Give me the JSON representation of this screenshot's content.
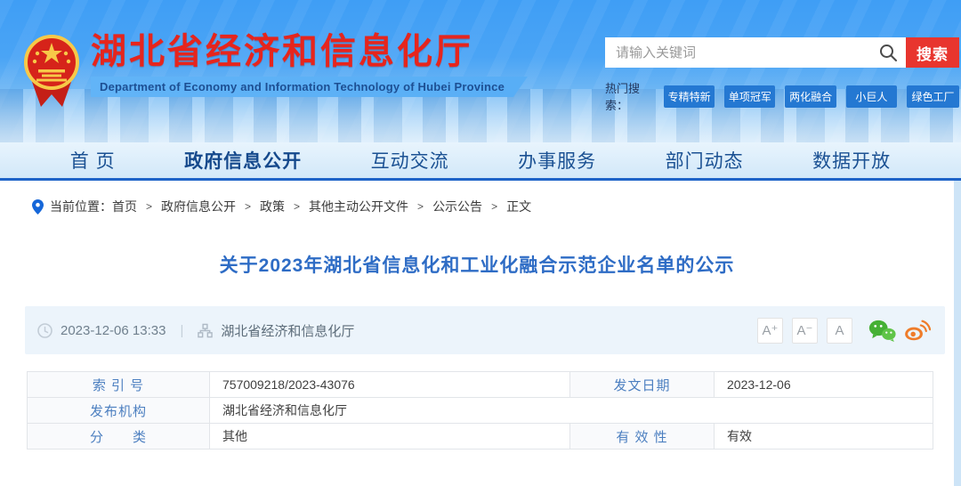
{
  "header": {
    "site_title": "湖北省经济和信息化厅",
    "site_subtitle": "Department of Economy and Information Technology of Hubei Province",
    "search": {
      "placeholder": "请输入关键词",
      "button_label": "搜索",
      "hot_label": "热门搜索：",
      "hot_tags": [
        "专精特新",
        "单项冠军",
        "两化融合",
        "小巨人",
        "绿色工厂"
      ]
    }
  },
  "nav": {
    "items": [
      {
        "label": "首 页",
        "active": false
      },
      {
        "label": "政府信息公开",
        "active": true
      },
      {
        "label": "互动交流",
        "active": false
      },
      {
        "label": "办事服务",
        "active": false
      },
      {
        "label": "部门动态",
        "active": false
      },
      {
        "label": "数据开放",
        "active": false
      }
    ]
  },
  "breadcrumb": {
    "label": "当前位置：",
    "separator": ">",
    "items": [
      "首页",
      "政府信息公开",
      "政策",
      "其他主动公开文件",
      "公示公告",
      "正文"
    ]
  },
  "article": {
    "title": "关于2023年湖北省信息化和工业化融合示范企业名单的公示",
    "publish_time": "2023-12-06 13:33",
    "divider": "|",
    "source": "湖北省经济和信息化厅",
    "font_size_buttons": {
      "larger": "A⁺",
      "smaller": "A⁻",
      "reset": "A"
    },
    "share_icons": [
      "wechat-icon",
      "weibo-icon"
    ]
  },
  "meta_table": {
    "index_label": "索 引 号",
    "index_value": "757009218/2023-43076",
    "issue_date_label": "发文日期",
    "issue_date_value": "2023-12-06",
    "agency_label": "发布机构",
    "agency_value": "湖北省经济和信息化厅",
    "category_label": "分　　类",
    "category_value": "其他",
    "validity_label": "有 效 性",
    "validity_value": "有效"
  },
  "colors": {
    "brand_red": "#e6251d",
    "header_blue": "#3f9ef5",
    "nav_text_blue": "#1b5193",
    "nav_underline_blue": "#1e63c8",
    "title_blue": "#2e6cc5",
    "hot_tag_blue": "#2478d2",
    "search_button_red": "#e8352e",
    "meta_strip_bg": "#ecf4fb",
    "table_label_blue": "#4c7fc0",
    "wechat_green": "#45b035",
    "weibo_orange": "#ef7c2a"
  }
}
